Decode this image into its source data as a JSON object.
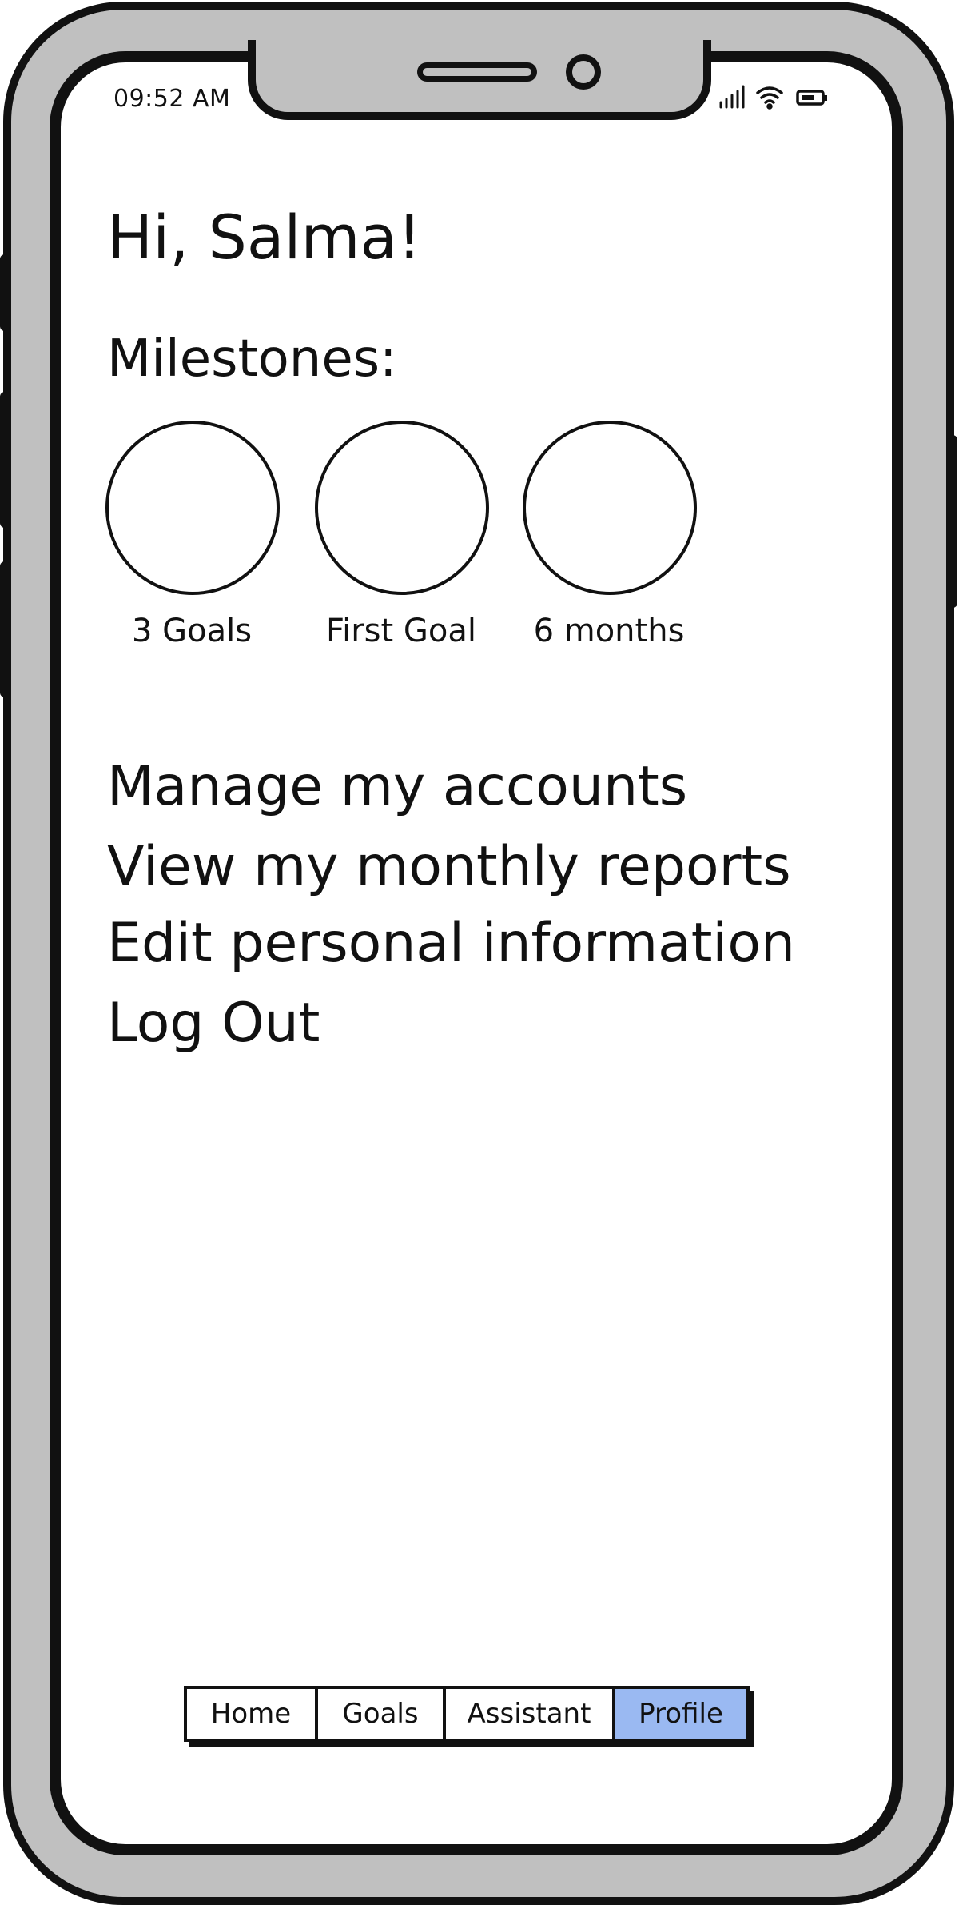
{
  "status_bar": {
    "time": "09:52 AM",
    "icons": [
      "signal-icon",
      "wifi-icon",
      "battery-icon"
    ]
  },
  "greeting": "Hi, Salma!",
  "milestones": {
    "title": "Milestones:",
    "items": [
      {
        "label": "3 Goals"
      },
      {
        "label": "First Goal"
      },
      {
        "label": "6 months"
      }
    ]
  },
  "menu": {
    "items": [
      {
        "label": "Manage my accounts"
      },
      {
        "label": "View my monthly reports"
      },
      {
        "label": "Edit personal information"
      },
      {
        "label": "Log Out"
      }
    ]
  },
  "tabbar": {
    "tabs": [
      {
        "label": "Home",
        "active": false
      },
      {
        "label": "Goals",
        "active": false
      },
      {
        "label": "Assistant",
        "active": false
      },
      {
        "label": "Profile",
        "active": true
      }
    ],
    "active_color": "#9ab9f2"
  },
  "colors": {
    "frame": "#c0c0c0",
    "screen": "#ffffff",
    "ink": "#111111"
  }
}
